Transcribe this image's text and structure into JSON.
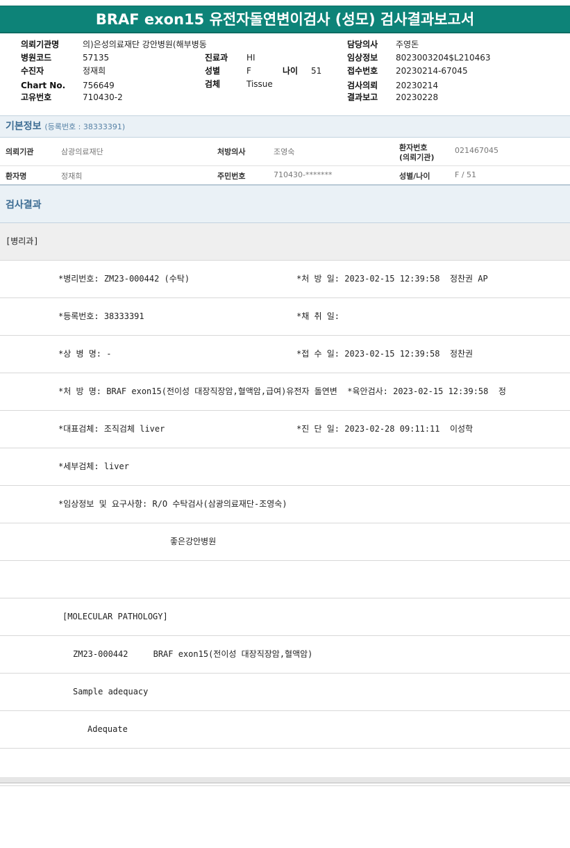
{
  "title": "BRAF exon15 유전자돌연변이검사 (성모) 검사결과보고서",
  "header": {
    "request_org_label": "의뢰기관명",
    "request_org_value": "의)은성의료재단 강안병원(해부병동",
    "hospital_code_label": "병원코드",
    "hospital_code_value": "57135",
    "dept_label": "진료과",
    "dept_value": "HI",
    "patient_label": "수진자",
    "patient_value": "정재희",
    "sex_label": "성별",
    "sex_value": "F",
    "age_label": "나이",
    "age_value": "51",
    "chart_label": "Chart No.",
    "chart_value": "756649",
    "specimen_label": "검체",
    "specimen_value": "Tissue",
    "unique_label": "고유번호",
    "unique_value": "710430-2",
    "doctor_label": "담당의사",
    "doctor_value": "주영돈",
    "clinical_label": "임상정보",
    "clinical_value": "8023003204$L210463",
    "receipt_label": "접수번호",
    "receipt_value": "20230214-67045",
    "request_date_label": "검사의뢰",
    "request_date_value": "20230214",
    "report_date_label": "결과보고",
    "report_date_value": "20230228"
  },
  "basic_info": {
    "title": "기본정보",
    "sub": "(등록번호 : 38333391)",
    "org_label": "의뢰기관",
    "org_value": "삼광의료재단",
    "prescriber_label": "처방의사",
    "prescriber_value": "조영숙",
    "patient_no_label_1": "환자번호",
    "patient_no_label_2": "(의뢰기관)",
    "patient_no_value": "021467045",
    "name_label": "환자명",
    "name_value": "정재희",
    "rrn_label": "주민번호",
    "rrn_value": "710430-*******",
    "sex_age_label": "성별/나이",
    "sex_age_value": "F / 51"
  },
  "results": {
    "title": "검사결과",
    "rows": [
      [
        "[병리과]"
      ],
      [
        "*병리번호: ZM23-000442 (수탁)",
        "*처 방 일: 2023-02-15 12:39:58  정찬권 AP"
      ],
      [
        "*등록번호: 38333391",
        "*채 취 일:"
      ],
      [
        "*상 병 명: -",
        "*접 수 일: 2023-02-15 12:39:58  정찬권"
      ],
      [
        "*처 방 명: BRAF exon15(전이성 대장직장암,혈액암,급여)유전자 돌연변  *육안검사: 2023-02-15 12:39:58  정"
      ],
      [
        "*대표검체: 조직검체 liver",
        "*진 단 일: 2023-02-28 09:11:11  이성학"
      ],
      [
        "*세부검체: liver"
      ],
      [
        "*임상정보 및 요구사항: R/O 수탁검사(삼광의료재단-조영숙)"
      ],
      [
        "좋은강안병원"
      ],
      [
        ""
      ],
      [
        "[MOLECULAR PATHOLOGY]"
      ],
      [
        "ZM23-000442     BRAF exon15(전이성 대장직장암,혈액암)"
      ],
      [
        "Sample adequacy"
      ],
      [
        "Adequate"
      ],
      [
        ""
      ]
    ]
  }
}
